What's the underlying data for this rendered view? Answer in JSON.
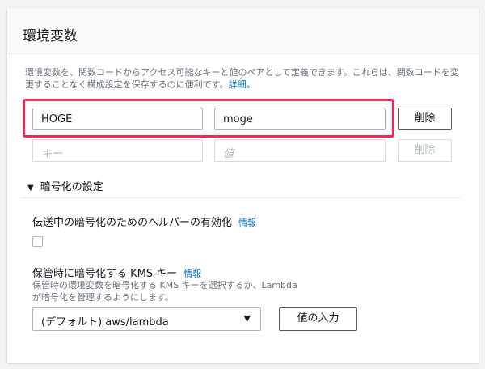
{
  "panel": {
    "title": "環境変数",
    "description": "環境変数を、関数コードからアクセス可能なキーと値のペアとして定義できます。これらは、関数コードを変更することなく構成設定を保存するのに便利です。",
    "details_link": "詳細。"
  },
  "rows": [
    {
      "key": "HOGE",
      "value": "moge",
      "delete": "削除"
    },
    {
      "key_placeholder": "キー",
      "value_placeholder": "値",
      "delete": "削除"
    }
  ],
  "encryption": {
    "header": "暗号化の設定",
    "transit_label": "伝送中の暗号化のためのヘルパーの有効化",
    "info": "情報",
    "kms_label": "保管時に暗号化する KMS キー",
    "kms_description": "保管時の環境変数を暗号化する KMS キーを選択するか、Lambda が暗号化を管理するようにします。",
    "kms_selected": "(デフォルト) aws/lambda",
    "enter_value": "値の入力"
  }
}
